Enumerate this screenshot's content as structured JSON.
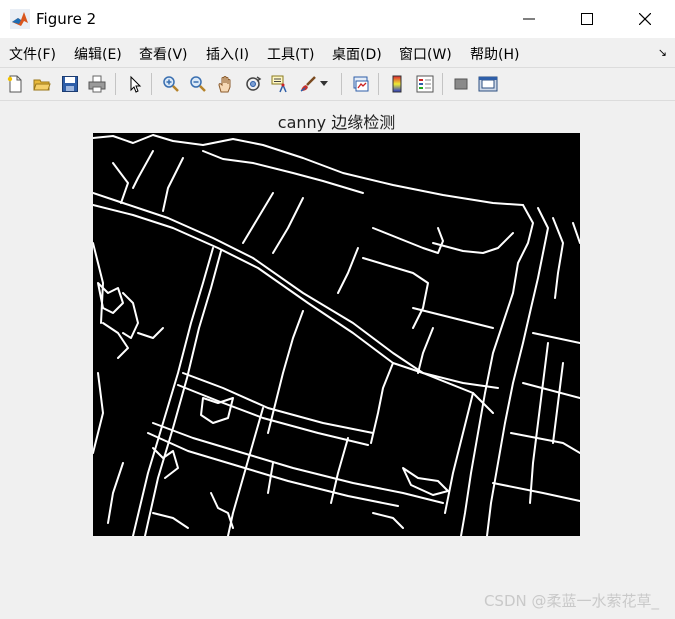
{
  "window": {
    "title": "Figure 2",
    "controls": [
      "minimize",
      "maximize",
      "close"
    ]
  },
  "menu": {
    "items": [
      {
        "label": "文件(F)"
      },
      {
        "label": "编辑(E)"
      },
      {
        "label": "查看(V)"
      },
      {
        "label": "插入(I)"
      },
      {
        "label": "工具(T)"
      },
      {
        "label": "桌面(D)"
      },
      {
        "label": "窗口(W)"
      },
      {
        "label": "帮助(H)"
      }
    ],
    "overflow_icon": "dock-arrow-icon"
  },
  "toolbar": {
    "icons": [
      "new-figure-icon",
      "open-file-icon",
      "save-icon",
      "print-icon",
      "pointer-icon",
      "zoom-in-icon",
      "zoom-out-icon",
      "pan-hand-icon",
      "rotate-3d-icon",
      "data-cursor-icon",
      "brush-icon",
      "brush-dropdown-icon",
      "link-plot-icon",
      "colorbar-icon",
      "legend-icon",
      "hide-plot-tools-icon",
      "show-plot-tools-icon"
    ]
  },
  "figure": {
    "title": "canny 边缘检测",
    "image_description_colors": {
      "background": "#000000",
      "edges": "#ffffff"
    }
  },
  "watermark": "CSDN @柔蓝一水萦花草_"
}
